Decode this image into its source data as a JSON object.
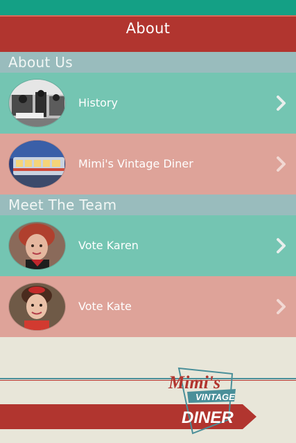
{
  "header": {
    "title": "About"
  },
  "sections": [
    {
      "title": "About Us",
      "items": [
        {
          "label": "History",
          "avatar": "vintage-diner-photo"
        },
        {
          "label": "Mimi's Vintage Diner",
          "avatar": "diner-exterior-photo"
        }
      ]
    },
    {
      "title": "Meet The Team",
      "items": [
        {
          "label": "Vote Karen",
          "avatar": "karen-portrait"
        },
        {
          "label": "Vote Kate",
          "avatar": "kate-portrait"
        }
      ]
    }
  ],
  "logo": {
    "line1": "Mimi's",
    "line2": "VINTAGE",
    "line3": "DINER"
  },
  "colors": {
    "status_bar": "#14a085",
    "header": "#b1352f",
    "section_header": "#99bcbd",
    "row_teal": "#74c5b2",
    "row_pink": "#dea399",
    "background": "#e8e6d9"
  }
}
